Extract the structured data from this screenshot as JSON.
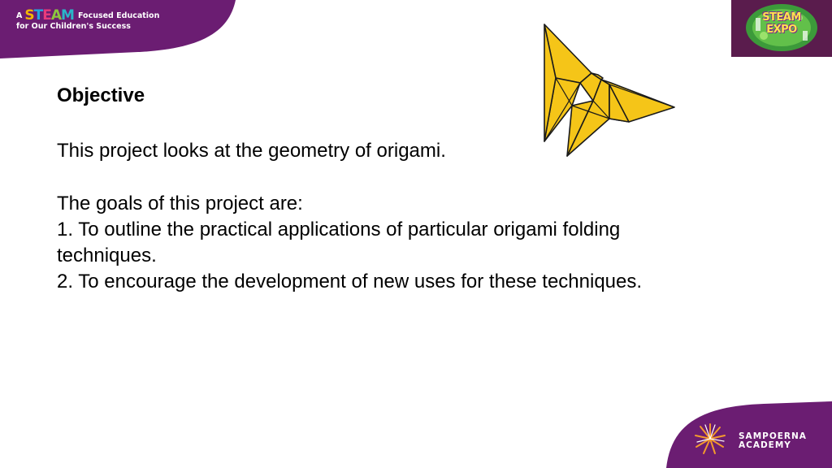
{
  "header": {
    "tagline_prefix": "A",
    "steam_letters": [
      "S",
      "T",
      "E",
      "A",
      "M"
    ],
    "tagline_suffix": "Focused Education",
    "tagline_line2": "for Our Children's Success"
  },
  "expo_logo": {
    "line1": "STEAM",
    "line2": "EXPO"
  },
  "slide": {
    "heading": "Objective",
    "intro": "This project looks at the geometry of origami.",
    "goals_title": "The goals of this project are:",
    "goals": [
      "1. To outline the practical applications of particular origami folding techniques.",
      "2. To encourage the development of new uses for these techniques."
    ]
  },
  "footer": {
    "academy_line1": "SAMPOERNA",
    "academy_line2": "ACADEMY"
  },
  "colors": {
    "brand_purple": "#6b1d72",
    "butterfly_fill": "#f5c518",
    "butterfly_stroke": "#1a1a1a",
    "academy_orange": "#f39a2d"
  }
}
